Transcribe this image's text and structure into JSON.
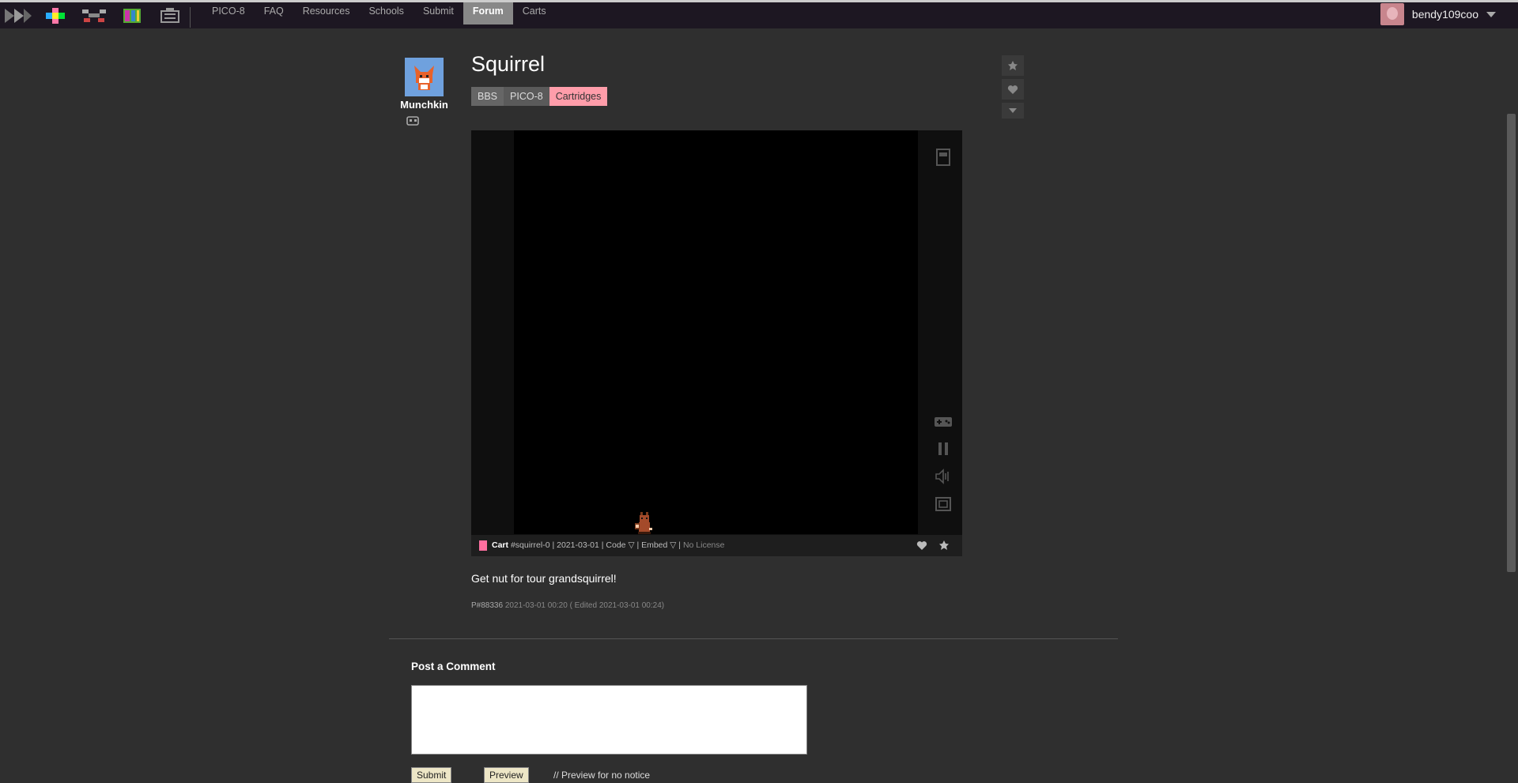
{
  "topbar": {
    "nav": [
      {
        "label": "PICO-8"
      },
      {
        "label": "FAQ"
      },
      {
        "label": "Resources"
      },
      {
        "label": "Schools"
      },
      {
        "label": "Submit"
      },
      {
        "label": "Forum"
      },
      {
        "label": "Carts"
      }
    ],
    "active_nav": "Forum",
    "username": "bendy109coo"
  },
  "post": {
    "author": "Munchkin",
    "title": "Squirrel",
    "breadcrumbs": [
      "BBS",
      "PICO-8",
      "Cartridges"
    ],
    "cart": {
      "label": "Cart",
      "id": "#squirrel-0",
      "date": "2021-03-01",
      "code_label": "Code ▽",
      "embed_label": "Embed ▽",
      "license": "No License",
      "sep": "|"
    },
    "body": "Get nut for tour grandsquirrel!",
    "post_id": "P#88336",
    "timestamp": "2021-03-01 00:20",
    "edited": "( Edited 2021-03-01 00:24)"
  },
  "comment": {
    "title": "Post a Comment",
    "submit_label": "Submit",
    "preview_label": "Preview",
    "hint": "// Preview for no notice"
  },
  "colors": {
    "accent_pink": "#ff9daa",
    "topbar_bg": "#1d1722",
    "page_bg": "#2f2f2f",
    "avatar_blue": "#6fa1de"
  }
}
